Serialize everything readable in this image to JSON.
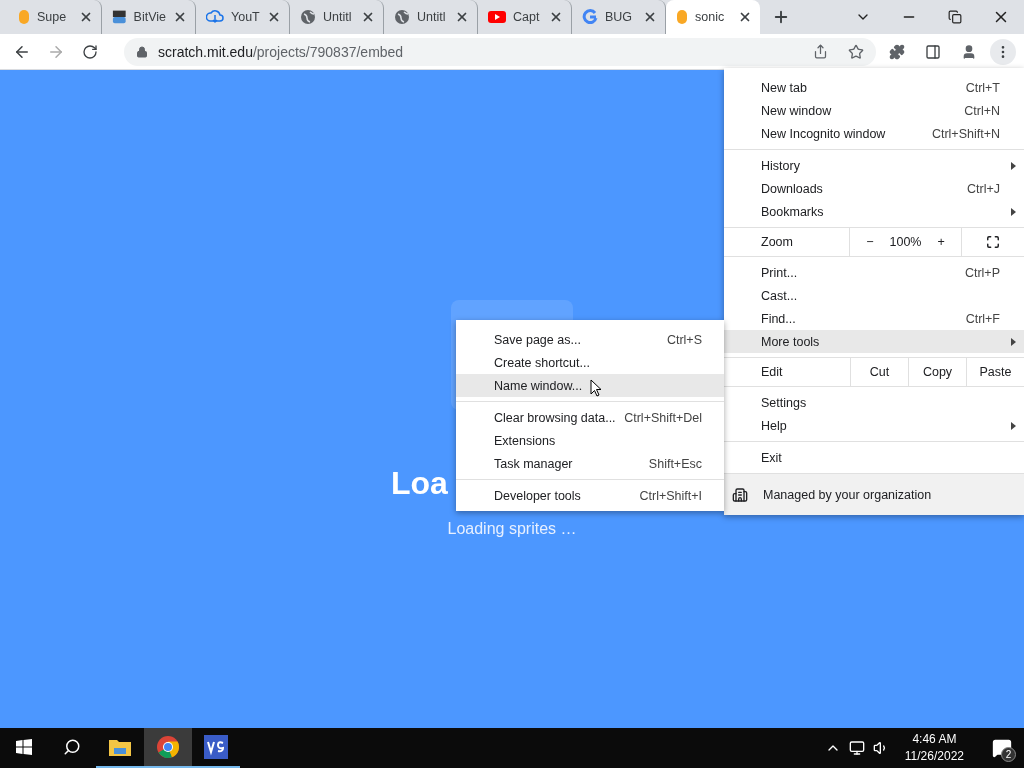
{
  "tabs": [
    {
      "kind": "scratch",
      "label": "Supe",
      "selected": false
    },
    {
      "kind": "bitview",
      "label": "BitVie",
      "selected": false
    },
    {
      "kind": "cloud",
      "label": "YouT",
      "selected": false
    },
    {
      "kind": "globe",
      "label": "Untitl",
      "selected": false
    },
    {
      "kind": "globe",
      "label": "Untitl",
      "selected": false
    },
    {
      "kind": "youtube",
      "label": "Capt",
      "selected": false
    },
    {
      "kind": "google",
      "label": "BUG",
      "selected": false
    },
    {
      "kind": "scratch",
      "label": "sonic",
      "selected": true
    }
  ],
  "address_bar": {
    "host": "scratch.mit.edu",
    "path": "/projects/790837/embed"
  },
  "page": {
    "title": "Loa",
    "status": "Loading sprites …"
  },
  "main_menu": {
    "sections": [
      [
        {
          "kind": "item",
          "label": "New tab",
          "shortcut": "Ctrl+T",
          "submenu": false,
          "selected": false
        },
        {
          "kind": "item",
          "label": "New window",
          "shortcut": "Ctrl+N",
          "submenu": false,
          "selected": false
        },
        {
          "kind": "item",
          "label": "New Incognito window",
          "shortcut": "Ctrl+Shift+N",
          "submenu": false,
          "selected": false
        }
      ],
      [
        {
          "kind": "item",
          "label": "History",
          "submenu": true,
          "selected": false
        },
        {
          "kind": "item",
          "label": "Downloads",
          "shortcut": "Ctrl+J",
          "submenu": false,
          "selected": false
        },
        {
          "kind": "item",
          "label": "Bookmarks",
          "submenu": true,
          "selected": false
        }
      ],
      [
        {
          "kind": "zoom",
          "label": "Zoom",
          "minus": "−",
          "value": "100%",
          "plus": "+"
        }
      ],
      [
        {
          "kind": "item",
          "label": "Print...",
          "shortcut": "Ctrl+P",
          "submenu": false,
          "selected": false
        },
        {
          "kind": "item",
          "label": "Cast...",
          "submenu": false,
          "selected": false
        },
        {
          "kind": "item",
          "label": "Find...",
          "shortcut": "Ctrl+F",
          "submenu": false,
          "selected": false
        },
        {
          "kind": "item",
          "label": "More tools",
          "submenu": true,
          "selected": true
        }
      ],
      [
        {
          "kind": "edit",
          "label": "Edit",
          "actions": [
            "Cut",
            "Copy",
            "Paste"
          ]
        }
      ],
      [
        {
          "kind": "item",
          "label": "Settings",
          "submenu": false,
          "selected": false
        },
        {
          "kind": "item",
          "label": "Help",
          "submenu": true,
          "selected": false
        }
      ],
      [
        {
          "kind": "item",
          "label": "Exit",
          "submenu": false,
          "selected": false
        }
      ],
      [
        {
          "kind": "managed",
          "label": "Managed by your organization"
        }
      ]
    ]
  },
  "more_tools_menu": {
    "sections": [
      [
        {
          "label": "Save page as...",
          "shortcut": "Ctrl+S",
          "selected": false
        },
        {
          "label": "Create shortcut...",
          "selected": false
        },
        {
          "label": "Name window...",
          "selected": true
        }
      ],
      [
        {
          "label": "Clear browsing data...",
          "shortcut": "Ctrl+Shift+Del",
          "selected": false
        },
        {
          "label": "Extensions",
          "selected": false
        },
        {
          "label": "Task manager",
          "shortcut": "Shift+Esc",
          "selected": false
        }
      ],
      [
        {
          "label": "Developer tools",
          "shortcut": "Ctrl+Shift+I",
          "selected": false
        }
      ]
    ]
  },
  "taskbar": {
    "apps": [
      {
        "kind": "folder",
        "running": true,
        "selected": false
      },
      {
        "kind": "chrome",
        "running": true,
        "selected": true
      },
      {
        "kind": "vs",
        "running": true,
        "selected": false
      }
    ],
    "time": "4:46 AM",
    "date": "11/26/2022",
    "notifications": "2"
  }
}
